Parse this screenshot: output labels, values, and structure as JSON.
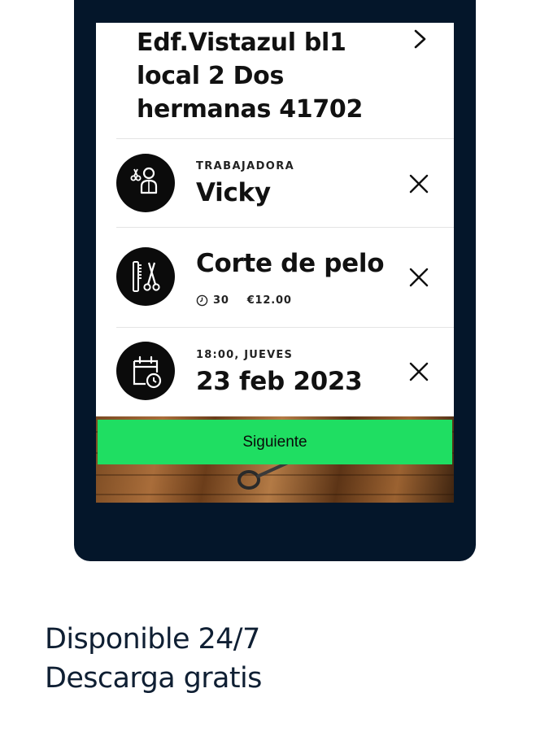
{
  "booking": {
    "address": "Edf.Vistazul bl1 local 2 Dos hermanas 41702",
    "worker": {
      "label": "TRABAJADORA",
      "name": "Vicky",
      "icon": "barber-icon"
    },
    "service": {
      "name": "Corte de pelo",
      "duration": "30",
      "price": "€12.00",
      "icon": "comb-scissors-icon"
    },
    "datetime": {
      "time_day": "18:00,  JUEVES",
      "date": "23 feb 2023",
      "icon": "calendar-icon"
    },
    "next_button_label": "Siguiente"
  },
  "promo": {
    "line1": "Disponible 24/7",
    "line2": "Descarga gratis"
  },
  "colors": {
    "phone_frame": "#04162a",
    "primary_button": "#1fde62",
    "icon_circle": "#0b0b0b",
    "tagline_text": "#0f1f33"
  }
}
